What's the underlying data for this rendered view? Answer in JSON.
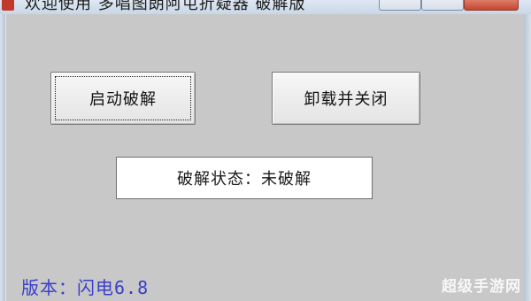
{
  "window": {
    "title": "欢迎使用 多唱图朗阿屯折疑器 破解版"
  },
  "buttons": {
    "start_label": "启动破解",
    "unload_label": "卸载并关闭"
  },
  "status": {
    "text": "破解状态：未破解"
  },
  "footer": {
    "version_prefix": "版本：闪电",
    "version_number": "6.8"
  },
  "watermark": {
    "text": "超级手游网"
  },
  "colors": {
    "background": "#c8c8c8",
    "version_text": "#3a3ec8",
    "status_bg": "#ffffff"
  },
  "icons": {
    "app": "app-icon",
    "minimize": "minimize-icon",
    "maximize": "maximize-icon",
    "close": "close-icon"
  }
}
